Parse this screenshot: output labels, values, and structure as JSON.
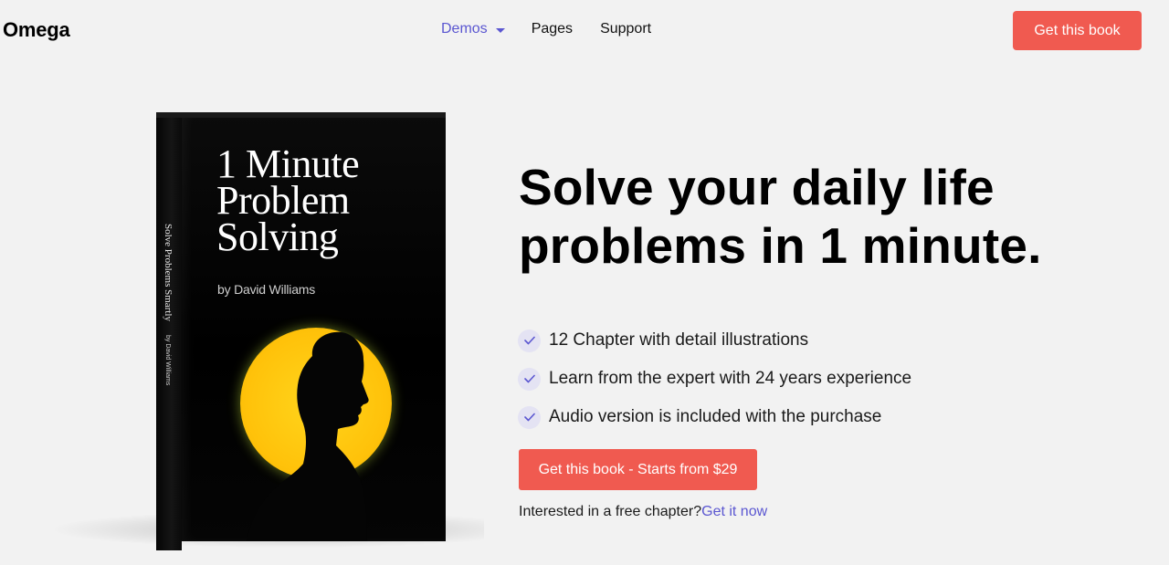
{
  "header": {
    "logo": "Omega",
    "nav": {
      "demos": "Demos",
      "pages": "Pages",
      "support": "Support"
    },
    "cta_label": "Get this book"
  },
  "book": {
    "title_lines": [
      "1 Minute",
      "Problem",
      "Solving"
    ],
    "author": "by David Williams",
    "spine_title": "Solve Problems Smartly",
    "spine_author": "by David Williams"
  },
  "hero": {
    "headline": "Solve your daily life problems in 1 minute.",
    "features": [
      "12 Chapter with detail illustrations",
      "Learn from the expert with 24 years experience",
      "Audio version is included with the purchase"
    ],
    "cta_label": "Get this book - Starts from $29",
    "free_chapter_text": "Interested in a free chapter?",
    "free_chapter_link": "Get it now"
  },
  "colors": {
    "accent": "#f05a50",
    "link": "#5b57d1",
    "background": "#f2f2f2",
    "check_bg": "#e4e3f3"
  }
}
